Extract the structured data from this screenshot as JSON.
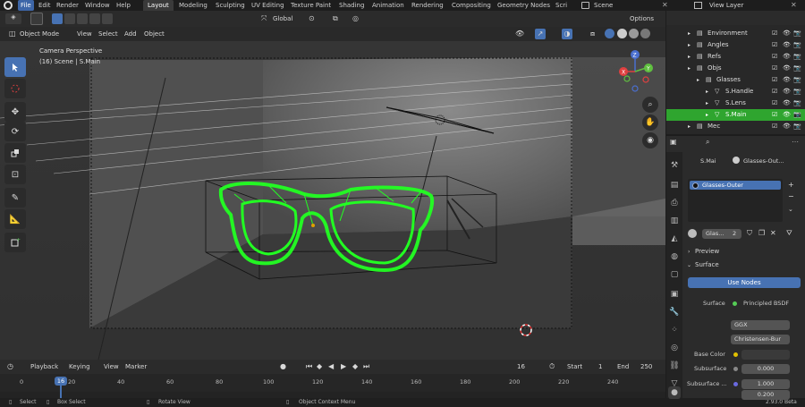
{
  "menus": [
    "File",
    "Edit",
    "Render",
    "Window",
    "Help"
  ],
  "workspaces": [
    "Layout",
    "Modeling",
    "Sculpting",
    "UV Editing",
    "Texture Paint",
    "Shading",
    "Animation",
    "Rendering",
    "Compositing",
    "Geometry Nodes",
    "Scri"
  ],
  "scene_name": "Scene",
  "view_layer": "View Layer",
  "viewport": {
    "mode": "Object Mode",
    "menu": [
      "View",
      "Select",
      "Add",
      "Object"
    ],
    "transform": "Global",
    "options": "Options",
    "overlay_title": "Camera Perspective",
    "overlay_sub": "(16) Scene | S.Main"
  },
  "outliner": {
    "rows": [
      {
        "label": "Environment",
        "indent": 1
      },
      {
        "label": "Angles",
        "indent": 1
      },
      {
        "label": "Refs",
        "indent": 1
      },
      {
        "label": "Objs",
        "indent": 1
      },
      {
        "label": "Glasses",
        "indent": 2
      },
      {
        "label": "S.Handle",
        "indent": 3
      },
      {
        "label": "S.Lens",
        "indent": 3
      },
      {
        "label": "S.Main",
        "indent": 3,
        "selected": true
      },
      {
        "label": "Mec",
        "indent": 1
      }
    ]
  },
  "properties": {
    "object": "S.Mai",
    "material_breadcrumb": "Glasses-Out...",
    "slot": "Glasses-Outer",
    "mat_name": "Glas...",
    "mat_users": "2",
    "preview": "Preview",
    "surface_panel": "Surface",
    "use_nodes": "Use Nodes",
    "surface_label": "Surface",
    "surface_value": "Principled BSDF",
    "dist1": "GGX",
    "dist2": "Christensen-Bur",
    "base_color_label": "Base Color",
    "subsurface_label": "Subsurface",
    "subsurface_value": "0.000",
    "subsurface_r_label": "Subsurface ...",
    "subsurface_r1": "1.000",
    "subsurface_r2": "0.200"
  },
  "timeline": {
    "menu": [
      "Playback",
      "Keying",
      "View",
      "Marker"
    ],
    "current_frame": "16",
    "start_label": "Start",
    "start": "1",
    "end_label": "End",
    "end": "250",
    "ticks": [
      "0",
      "20",
      "40",
      "60",
      "80",
      "100",
      "120",
      "140",
      "160",
      "180",
      "200",
      "220",
      "240"
    ]
  },
  "status": {
    "select": "Select",
    "box": "Box Select",
    "rotate": "Rotate View",
    "context": "Object Context Menu",
    "version": "2.93.0 Beta"
  },
  "colors": {
    "accent": "#4772b3",
    "selection": "#2fa52f",
    "wire": "#22ff22"
  }
}
